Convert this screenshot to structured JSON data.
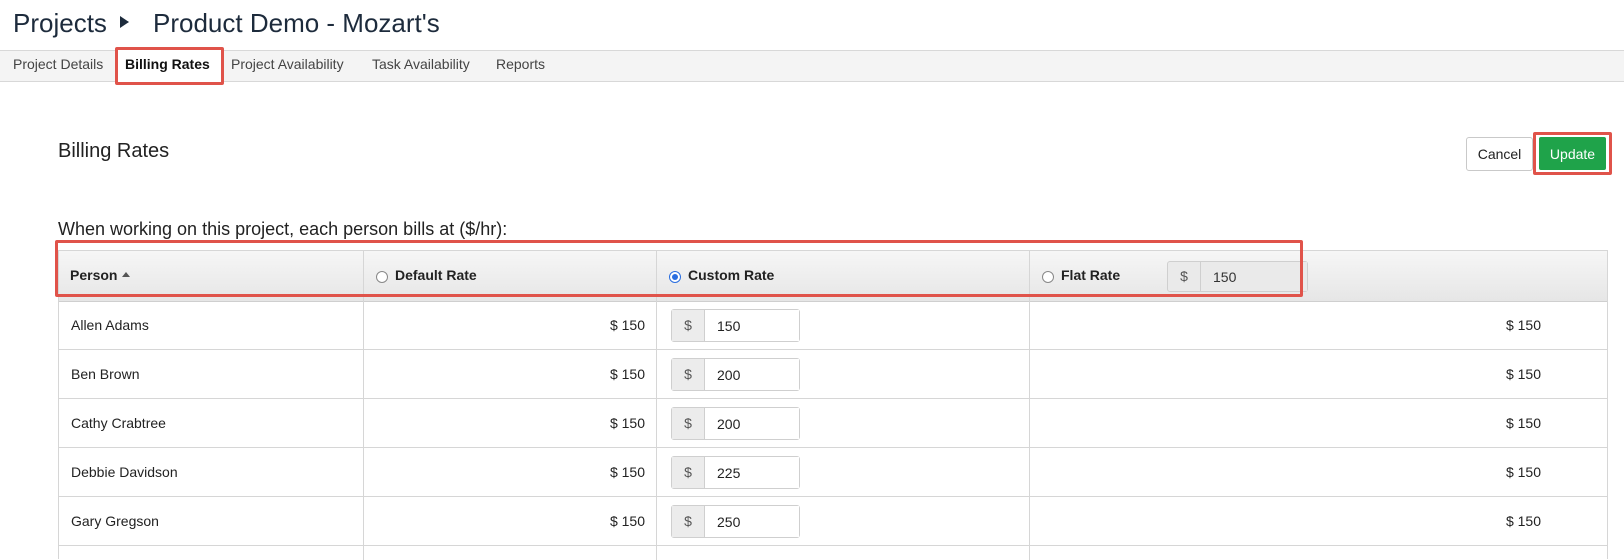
{
  "breadcrumb": {
    "root": "Projects",
    "current": "Product Demo - Mozart's"
  },
  "tabs": [
    {
      "label": "Project Details"
    },
    {
      "label": "Billing Rates",
      "active": true
    },
    {
      "label": "Project Availability"
    },
    {
      "label": "Task Availability"
    },
    {
      "label": "Reports"
    }
  ],
  "section": {
    "title": "Billing Rates",
    "cancel_label": "Cancel",
    "update_label": "Update"
  },
  "intro": "When working on this project, each person bills at ($/hr):",
  "table": {
    "headers": {
      "person": "Person",
      "default_rate": "Default Rate",
      "custom_rate": "Custom Rate",
      "flat_rate": "Flat Rate",
      "flat_currency": "$",
      "flat_value": "150"
    },
    "selected_rate_option": "Custom Rate",
    "rows": [
      {
        "name": "Allen Adams",
        "default": "$ 150",
        "currency": "$",
        "custom": "150",
        "flat": "$ 150"
      },
      {
        "name": "Ben Brown",
        "default": "$ 150",
        "currency": "$",
        "custom": "200",
        "flat": "$ 150"
      },
      {
        "name": "Cathy Crabtree",
        "default": "$ 150",
        "currency": "$",
        "custom": "200",
        "flat": "$ 150"
      },
      {
        "name": "Debbie Davidson",
        "default": "$ 150",
        "currency": "$",
        "custom": "225",
        "flat": "$ 150"
      },
      {
        "name": "Gary Gregson",
        "default": "$ 150",
        "currency": "$",
        "custom": "250",
        "flat": "$ 150"
      }
    ]
  },
  "colors": {
    "accent_green": "#1fa34a",
    "highlight_red": "#e0534a",
    "radio_blue": "#2a6ee0"
  }
}
